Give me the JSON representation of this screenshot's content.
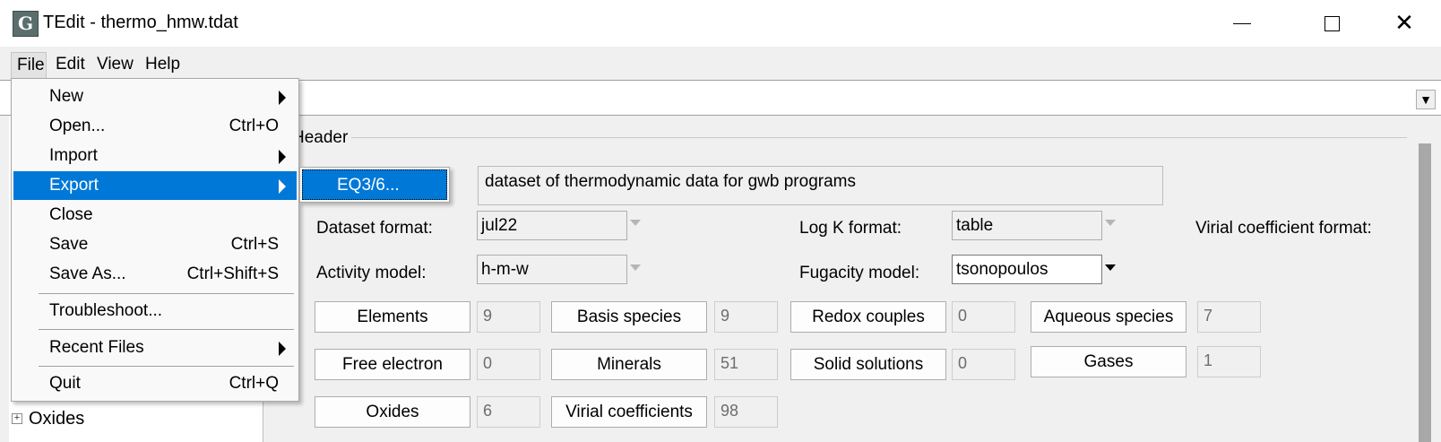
{
  "window": {
    "title": "TEdit - thermo_hmw.tdat",
    "icon_letter": "G",
    "minimize_glyph": "",
    "close_glyph": "✕"
  },
  "menubar": {
    "file": "File",
    "edit": "Edit",
    "view": "View",
    "help": "Help"
  },
  "file_menu": {
    "items": [
      {
        "label": "New",
        "shortcut": "",
        "submenu": true
      },
      {
        "label": "Open...",
        "shortcut": "Ctrl+O",
        "submenu": false
      },
      {
        "label": "Import",
        "shortcut": "",
        "submenu": true
      },
      {
        "label": "Export",
        "shortcut": "",
        "submenu": true,
        "active": true
      },
      {
        "label": "Close",
        "shortcut": "",
        "submenu": false
      },
      {
        "label": "Save",
        "shortcut": "Ctrl+S",
        "submenu": false
      },
      {
        "label": "Save As...",
        "shortcut": "Ctrl+Shift+S",
        "submenu": false
      },
      {
        "label": "Troubleshoot...",
        "shortcut": "",
        "submenu": false
      },
      {
        "label": "Recent Files",
        "shortcut": "",
        "submenu": true
      },
      {
        "label": "Quit",
        "shortcut": "Ctrl+Q",
        "submenu": false
      }
    ],
    "export_submenu": [
      "EQ3/6..."
    ]
  },
  "tree": {
    "visible_node": "Oxides",
    "partial_node": ""
  },
  "header_group": {
    "title": "Header",
    "description": "dataset of thermodynamic data for gwb programs",
    "dataset_format_label": "Dataset format:",
    "dataset_format_value": "jul22",
    "logk_format_label": "Log K format:",
    "logk_format_value": "table",
    "virial_format_label": "Virial coefficient format:",
    "activity_model_label": "Activity model:",
    "activity_model_value": "h-m-w",
    "fugacity_model_label": "Fugacity model:",
    "fugacity_model_value": "tsonopoulos"
  },
  "counts": [
    {
      "label": "Elements",
      "value": "9"
    },
    {
      "label": "Basis species",
      "value": "9"
    },
    {
      "label": "Redox couples",
      "value": "0"
    },
    {
      "label": "Aqueous species",
      "value": "7"
    },
    {
      "label": "Free electron",
      "value": "0"
    },
    {
      "label": "Minerals",
      "value": "51"
    },
    {
      "label": "Solid solutions",
      "value": "0"
    },
    {
      "label": "Gases",
      "value": "1"
    },
    {
      "label": "Oxides",
      "value": "6"
    },
    {
      "label": "Virial coefficients",
      "value": "98"
    }
  ],
  "colors": {
    "menu_highlight": "#0078d7",
    "window_bg": "#f0f0f0"
  }
}
